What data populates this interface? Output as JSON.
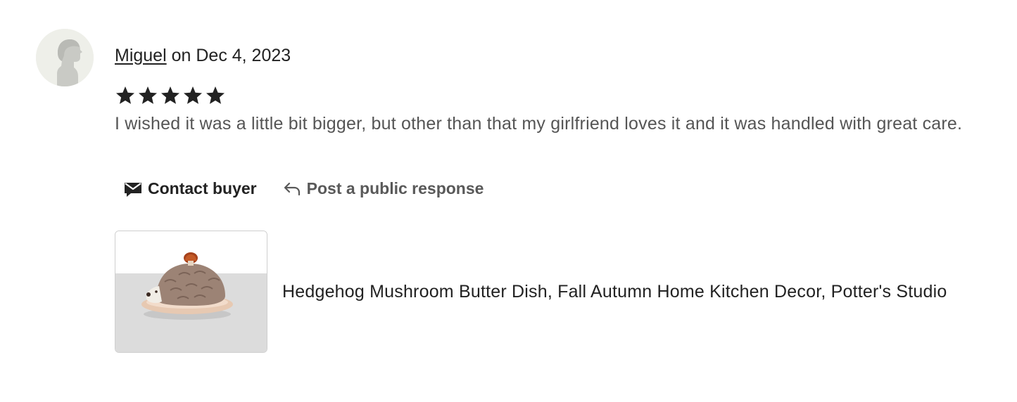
{
  "review": {
    "reviewer_name": "Miguel",
    "date_text": " on Dec 4, 2023",
    "rating": 5,
    "max_rating": 5,
    "text": "I wished it was a little bit bigger, but other than that my girlfriend loves it and it was handled with great care."
  },
  "actions": {
    "contact_label": "Contact buyer",
    "respond_label": "Post a public response",
    "contact_icon": "envelope-icon",
    "respond_icon": "reply-arrow-icon"
  },
  "product": {
    "title": "Hedgehog Mushroom Butter Dish, Fall Autumn Home Kitchen Decor, Potter's Studio"
  },
  "colors": {
    "text_primary": "#222222",
    "text_secondary": "#555555",
    "avatar_bg": "#eeefe9",
    "star": "#222222"
  }
}
